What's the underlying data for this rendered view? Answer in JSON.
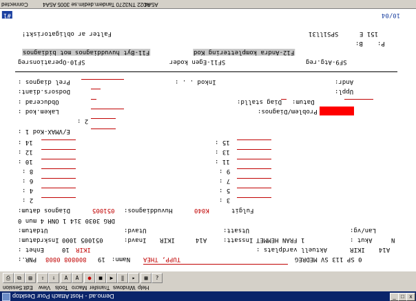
{
  "window": {
    "title": "Demo.ad - Host Attach Pour Desktop",
    "minimize": "_",
    "maximize": "□",
    "close": "x"
  },
  "menubar": [
    "Session",
    "Edit",
    "View",
    "Tools",
    "Macro",
    "Transfer",
    "Windows",
    "Help"
  ],
  "topbar": {
    "connected": "Connected",
    "session_info": "A022 TN3270 Tandem.dedim.se 3005 A5A4",
    "session_label": "A5A4"
  },
  "screen": {
    "header": {
      "page_indicator": "10/04",
      "marker": "#1"
    },
    "title_line": {
      "text": "Falter ar obligatoriskt!",
      "screen_id": "SPS1ll31",
      "page_label": "151 E"
    },
    "b_p": {
      "b": "B:",
      "p": "P:"
    },
    "function_keys": [
      {
        "key": "F11",
        "label": "F11-Byt huvuddiagnos mot bidiagnos"
      },
      {
        "key": "F12",
        "label": "F12-Andra komplettering Kod"
      }
    ],
    "function_keys2": [
      "SF10-Operationsreg",
      "SF11-Egen koder",
      "SF9-Atg.reg"
    ],
    "left_labels": {
      "prel_diagnos": "Prel diagnos :",
      "dodsorsak": "Dodsors.diant:",
      "obducerad": "Obducerad    :",
      "lakem_kod": "Lakem.kod :",
      "extra_2": "2 :",
      "evmax_kod": "E/VMAX-Kod 1 :"
    },
    "right_labels": {
      "inkod": "Inkod  . . :",
      "andr": "Andr:",
      "uppl": "Uppl:",
      "diag_stalld": "Diag stalld:",
      "datum": "Datum:",
      "problem_diagnos": "Problem/Diagnos:"
    },
    "left_numbers": [
      "14 :",
      "12 :",
      "10 :",
      "8 :",
      "6 :",
      "4 :",
      "2 :"
    ],
    "right_numbers": [
      "15 :",
      "13 :",
      "11 :",
      "9 :",
      "7 :",
      "5 :",
      "3 :"
    ],
    "diag_line": {
      "label": "Diagnos datum:",
      "date": "051005",
      "main_label": "Huvuddiagnos:",
      "main_value": "K040",
      "tail": "Fulgit"
    },
    "drg_line": "DRG    3030  3i4 1 ONH 4 mun 0",
    "utdatum_line": {
      "utdatum": "Utdatum:",
      "utavd": "Utavd:",
      "utsatt": "Utsatt:",
      "lan_vg": "Lan/vg:"
    },
    "inskrivning_line": {
      "inskrdatum_label": "Inskrdatum:",
      "inskrdatum": "051005 1000",
      "inavd_label": "Inavd:",
      "inavd": "IKIR",
      "inavd2": "A14",
      "inssatt_label": "Inssatt:",
      "inssatt": "1  FRAN HEMMET",
      "akut_label": "Akut :",
      "akut": "N"
    },
    "enhet_line": {
      "enhet_label": "Enhet  :",
      "enhet": "10",
      "enhet_code": "IKIR",
      "aktuell_label": "Aktuell vardplats  :",
      "aktuell": "IKIR",
      "aktuell2": "A14"
    },
    "patient_line": {
      "pnr_label": "PNR.:",
      "pnr": "800808 0808",
      "age": "19",
      "namn_label": "Namn:",
      "namn": "TUPP, THEA",
      "tail": "0 SP 113 SV MEDREG"
    }
  },
  "toolbar": [
    "print",
    "copy",
    "paste",
    "send",
    "receive",
    "font-a",
    "font-a2",
    "record",
    "stop",
    "play",
    "pause",
    "step",
    "macro",
    "help"
  ],
  "colors": {
    "title_bg": "#0a246a",
    "chrome_bg": "#d4d0c8",
    "field_red": "#c00000",
    "error_red": "#ff0000",
    "accent_blue": "#1a3fa0"
  }
}
